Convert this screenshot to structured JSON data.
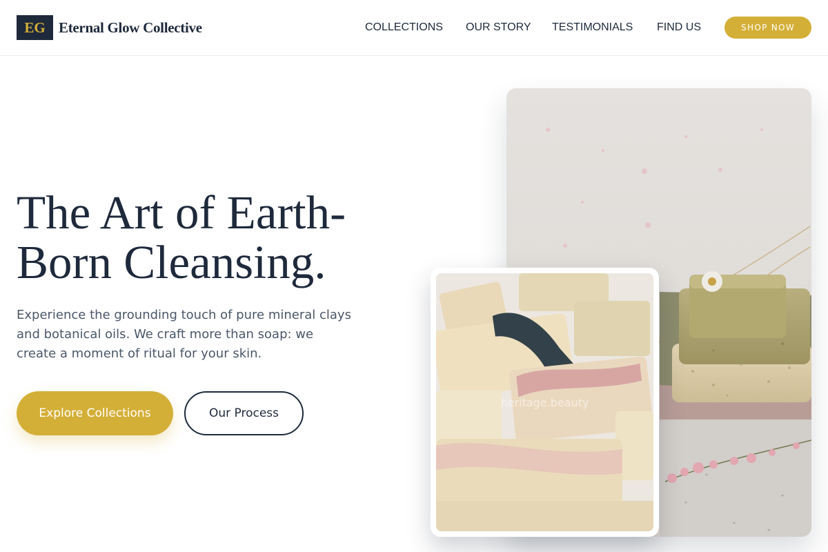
{
  "brand": {
    "mark": "EG",
    "name": "Eternal Glow Collective"
  },
  "nav": {
    "items": [
      {
        "label": "COLLECTIONS"
      },
      {
        "label": "OUR STORY"
      },
      {
        "label": "TESTIMONIALS"
      },
      {
        "label": "FIND US"
      }
    ],
    "cta_label": "SHOP NOW"
  },
  "hero": {
    "headline_line1": "The Art of Earth-",
    "headline_line2": "Born Cleansing.",
    "subtext_line1": "Experience the grounding touch of pure mineral clays",
    "subtext_line2": "and botanical oils. We craft more than soap: we",
    "subtext_line3": "create a moment of ritual for your skin.",
    "primary_button": "Explore Collections",
    "secondary_button": "Our Process"
  },
  "images": {
    "inset_watermark": "heritage.beauty"
  },
  "colors": {
    "navy": "#1e293b",
    "gold": "#d4af37",
    "body_text": "#4b5768",
    "background": "#ffffff"
  }
}
